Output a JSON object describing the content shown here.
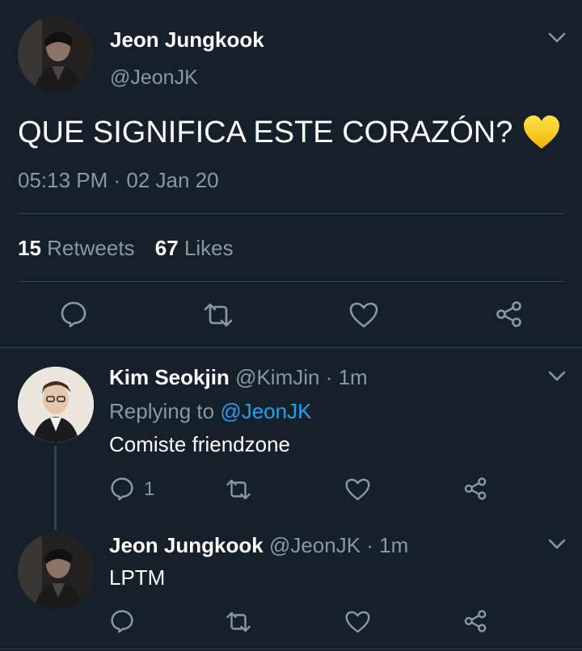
{
  "main_tweet": {
    "author_name": "Jeon Jungkook",
    "author_handle": "@JeonJK",
    "text": "QUE SIGNIFICA ESTE CORAZÓN?",
    "emoji": "💛",
    "timestamp": "05:13 PM · 02 Jan 20",
    "retweets_count": "15",
    "retweets_label": "Retweets",
    "likes_count": "67",
    "likes_label": "Likes"
  },
  "replies": [
    {
      "author_name": "Kim Seokjin",
      "author_handle": "@KimJin",
      "time": "· 1m",
      "replying_prefix": "Replying to",
      "replying_to": "@JeonJK",
      "text": "Comiste friendzone",
      "reply_count": "1"
    },
    {
      "author_name": "Jeon Jungkook",
      "author_handle": "@JeonJK",
      "time": "· 1m",
      "text": "LPTM"
    }
  ],
  "icons": {
    "reply": "reply-icon",
    "retweet": "retweet-icon",
    "like": "heart-icon",
    "share": "share-icon",
    "menu": "chevron-down-icon"
  },
  "colors": {
    "background": "#15202b",
    "muted_text": "#8899a6",
    "link": "#1da1f2",
    "divider": "#38444d"
  }
}
